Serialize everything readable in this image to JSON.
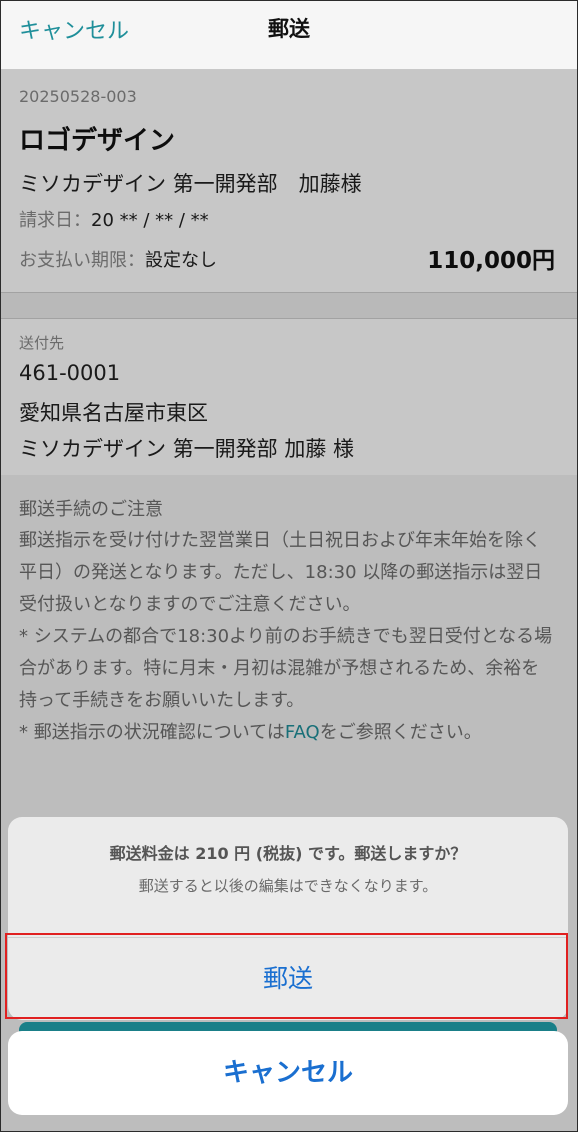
{
  "nav": {
    "cancel_label": "キャンセル",
    "title": "郵送"
  },
  "invoice": {
    "number": "20250528-003",
    "title": "ロゴデザイン",
    "client": "ミソカデザイン 第一開発部　加藤様",
    "date_label": "請求日：",
    "date_value": "20 ** / ** / **",
    "due_label": "お支払い期限：",
    "due_value": "設定なし",
    "amount": "110,000円"
  },
  "address": {
    "label": "送付先",
    "postal": "461-0001",
    "line1": "愛知県名古屋市東区",
    "line2": "ミソカデザイン  第一開発部 加藤 様"
  },
  "notice": {
    "title": "郵送手続のご注意",
    "p1": "郵送指示を受け付けた翌営業日（土日祝日および年末年始を除く平日）の発送となります。ただし、18:30 以降の郵送指示は翌日受付扱いとなりますのでご注意ください。",
    "p2": "* システムの都合で18:30より前のお手続きでも翌日受付となる場合があります。特に月末・月初は混雑が予想されるため、余裕を持って手続きをお願いいたします。",
    "p3_prefix": "* 郵送指示の状況確認については",
    "faq_label": "FAQ",
    "p3_suffix": "をご参照ください。"
  },
  "sheet": {
    "message": "郵送料金は 210 円 (税抜) です。郵送しますか？",
    "submessage": "郵送すると以後の編集はできなくなります。",
    "confirm_label": "郵送",
    "cancel_label": "キャンセル"
  },
  "colors": {
    "accent": "#1f8f9a",
    "ios_blue": "#1a6fd0",
    "highlight": "#e02020"
  }
}
